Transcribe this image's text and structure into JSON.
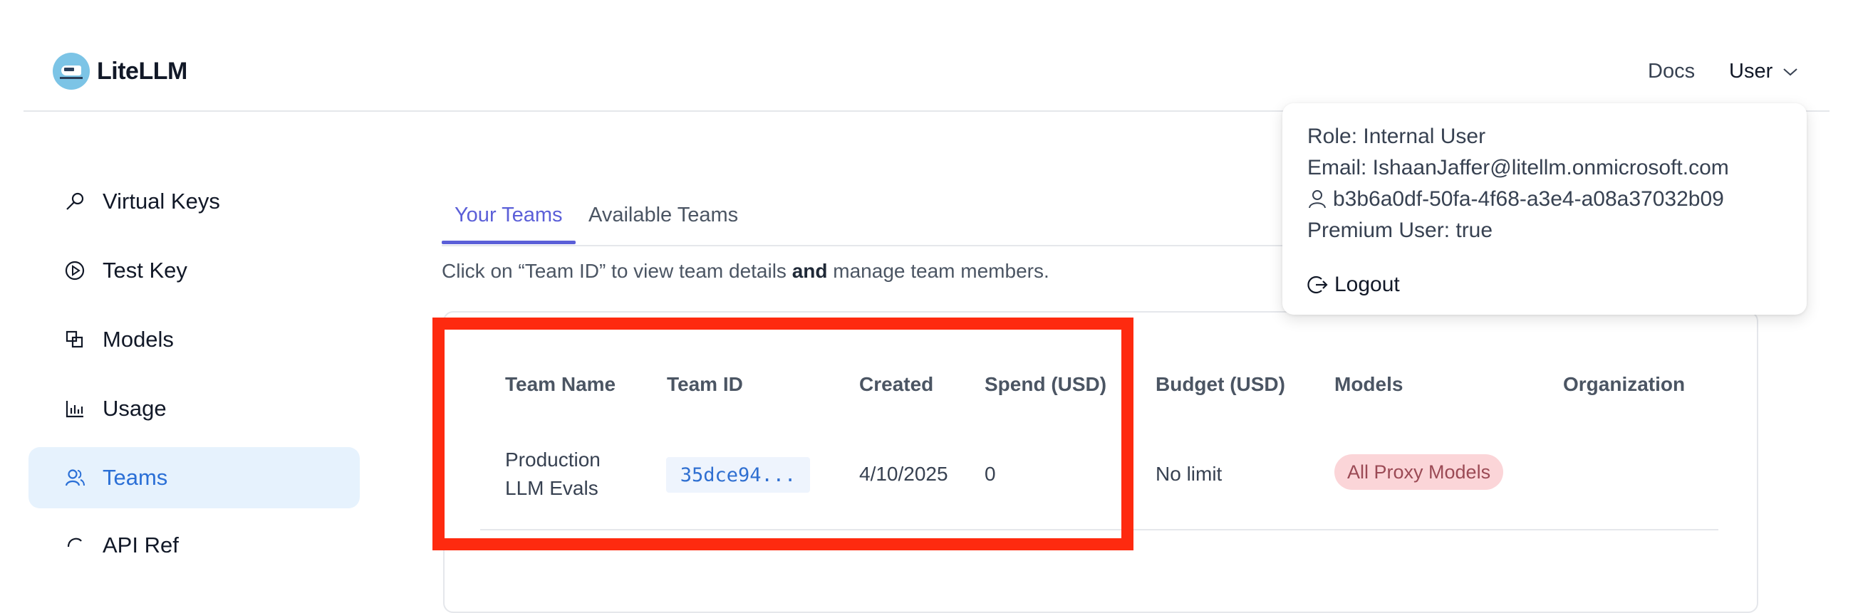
{
  "header": {
    "brand": "LiteLLM",
    "docs_label": "Docs",
    "user_label": "User"
  },
  "sidebar": {
    "items": [
      {
        "label": "Virtual Keys",
        "icon": "key-icon"
      },
      {
        "label": "Test Key",
        "icon": "play-circle-icon"
      },
      {
        "label": "Models",
        "icon": "block-icon"
      },
      {
        "label": "Usage",
        "icon": "bar-chart-icon"
      },
      {
        "label": "Teams",
        "icon": "team-icon",
        "active": true
      },
      {
        "label": "API Ref",
        "icon": "api-icon"
      }
    ]
  },
  "tabs": [
    {
      "label": "Your Teams",
      "active": true
    },
    {
      "label": "Available Teams"
    }
  ],
  "hint": {
    "before": "Click on “Team ID” to view team details ",
    "bold": "and",
    "after": " manage team members."
  },
  "table": {
    "columns": [
      "Team Name",
      "Team ID",
      "Created",
      "Spend (USD)",
      "Budget (USD)",
      "Models",
      "Organization"
    ],
    "rows": [
      {
        "team_name_line1": "Production",
        "team_name_line2": "LLM Evals",
        "team_id": "35dce94...",
        "created": "4/10/2025",
        "spend": "0",
        "budget": "No limit",
        "models": "All Proxy Models",
        "organization": ""
      }
    ]
  },
  "user_dropdown": {
    "role": "Role: Internal User",
    "email": "Email: IshaanJaffer@litellm.onmicrosoft.com",
    "user_id": "b3b6a0df-50fa-4f68-a3e4-a08a37032b09",
    "premium": "Premium User: true",
    "logout": "Logout"
  },
  "colors": {
    "accent": "#5b5fd8",
    "active_bg": "#e6f2fd",
    "highlight": "#fe2a0f",
    "model_pill_bg": "#fbd5d8"
  }
}
